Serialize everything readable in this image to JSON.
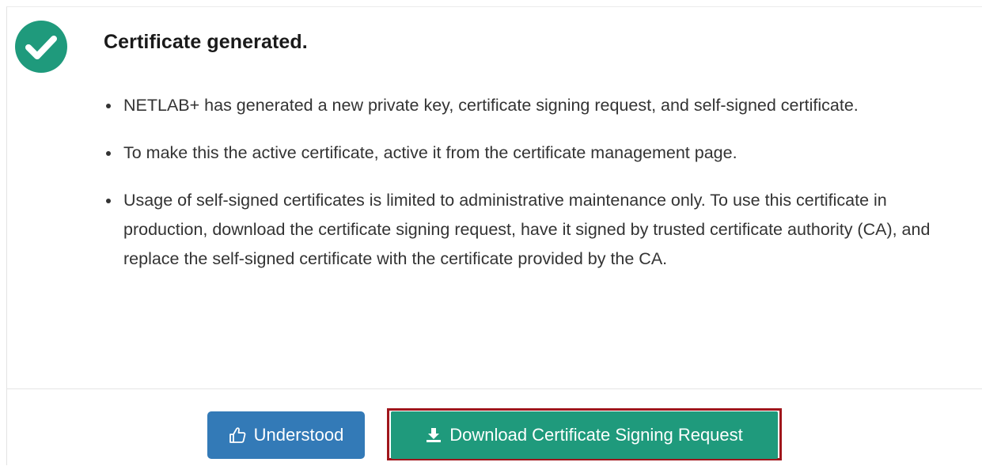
{
  "notice": {
    "status_icon": "check-circle-icon",
    "title": "Certificate generated.",
    "bullets": [
      {
        "text": "NETLAB+ has generated a new private key, certificate signing request, and self-signed certificate."
      },
      {
        "text": "To make this the active certificate, active it from the certificate management page."
      },
      {
        "text": "Usage of self-signed certificates is limited to administrative maintenance only. To use this certificate in production, download the certificate signing request, have it signed by trusted certificate authority (CA), and replace the self-signed certificate with the certificate provided by the CA."
      }
    ]
  },
  "actions": {
    "understood": {
      "label": "Understood",
      "icon": "thumbs-up-icon"
    },
    "download": {
      "label": "Download Certificate Signing Request",
      "icon": "download-icon"
    }
  },
  "colors": {
    "success": "#1f9a7c",
    "primary": "#337ab7",
    "highlight_border": "#a0161c"
  }
}
